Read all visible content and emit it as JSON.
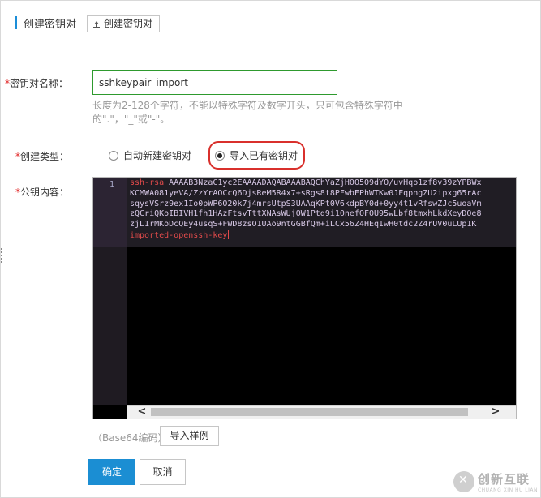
{
  "header": {
    "title": "创建密钥对",
    "button_label": "创建密钥对",
    "button_icon": "upload-icon"
  },
  "form": {
    "name": {
      "required_mark": "*",
      "label": "密钥对名称：",
      "value": "sshkeypair_import",
      "hint_line1": "长度为2-128个字符，不能以特殊字符及数字开头，只可包含特殊字符中",
      "hint_line2": "的\".\"，\"_\"或\"-\"。"
    },
    "create_type": {
      "required_mark": "*",
      "label": "创建类型：",
      "options": [
        {
          "label": "自动新建密钥对",
          "checked": false
        },
        {
          "label": "导入已有密钥对",
          "checked": true
        }
      ]
    },
    "public_key": {
      "required_mark": "*",
      "label": "公钥内容：",
      "line_number": "1",
      "key_type": "ssh-rsa",
      "line1_rest": " AAAAB3NzaC1yc2EAAAADAQABAAABAQChYaZjH0O5O9dYO/uvHqo1zf8v39zYPBWx",
      "line2": "KCMWA081yeVA/ZzYrAOCcQ6DjsReM5R4x7+sRgs8t8PFwbEPhWTKw0JFqpngZU2ipxg65rAc",
      "line3": "sqysVSrz9ex1Io0pWP6O20k7j4mrsUtpS3UAAqKPt0V6kdpBY0d+0yy4t1vRfswZJc5uoaVm",
      "line4": "zQCriQKoIBIVH1fh1HAzFtsvTttXNAsWUjOW1Ptq9i10nefOFOU95wLbf8tmxhLkdXeyDOe8",
      "line5": "zjL1rMKoDcQEy4usqS+FWD8zsO1UAo9ntGGBfQm+iLCx56Z4HEqIwH0tdc2Z4rUV0uLUp1K",
      "comment": "imported-openssh-key",
      "scroll_left": "<",
      "scroll_right": ">"
    },
    "encoding_note": "（Base64编码）",
    "import_sample_label": "导入样例"
  },
  "footer": {
    "ok_label": "确定",
    "cancel_label": "取消"
  },
  "watermark": {
    "main": "创新互联",
    "sub": "CHUANG XIN HU LIAN"
  },
  "colors": {
    "accent": "#1b8ed3",
    "required": "#e02020",
    "input_border_valid": "#2e9a2e",
    "highlight": "#d9302c"
  }
}
